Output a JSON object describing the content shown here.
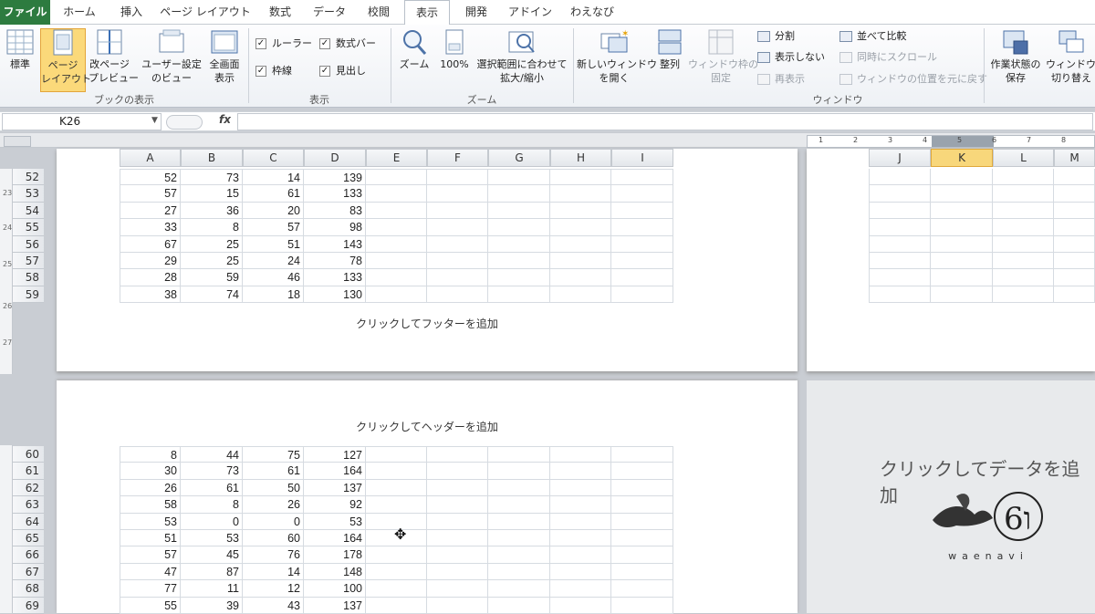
{
  "tabs": [
    "ファイル",
    "ホーム",
    "挿入",
    "ページ レイアウト",
    "数式",
    "データ",
    "校閲",
    "表示",
    "開発",
    "アドイン",
    "わえなび"
  ],
  "ribbon": {
    "workbook_views": {
      "normal": "標準",
      "page_layout": "ページ\nレイアウト",
      "page_break": "改ページ\nプレビュー",
      "custom": "ユーザー設定\nのビュー",
      "fullscreen": "全画面\n表示",
      "group": "ブックの表示"
    },
    "show": {
      "ruler": "ルーラー",
      "formula_bar": "数式バー",
      "gridlines": "枠線",
      "headings": "見出し",
      "group": "表示"
    },
    "zoom": {
      "zoom": "ズーム",
      "hundred": "100%",
      "selection": "選択範囲に合わせて\n拡大/縮小",
      "group": "ズーム"
    },
    "window": {
      "new_window": "新しいウィンドウ\nを開く",
      "arrange": "整列",
      "freeze": "ウィンドウ枠の\n固定",
      "split": "分割",
      "hide": "表示しない",
      "unhide": "再表示",
      "side_by_side": "並べて比較",
      "sync_scroll": "同時にスクロール",
      "reset_pos": "ウィンドウの位置を元に戻す",
      "save_ws": "作業状態の\n保存",
      "switch": "ウィンドウの\n切り替え",
      "group": "ウィンドウ"
    }
  },
  "namebox": "K26",
  "fx": "fx",
  "left_cols": [
    "A",
    "B",
    "C",
    "D",
    "E",
    "F",
    "G",
    "H",
    "I"
  ],
  "right_cols": [
    "J",
    "K",
    "L",
    "M"
  ],
  "footer_text": "クリックしてフッターを追加",
  "header_text": "クリックしてヘッダーを追加",
  "add_data_text": "クリックしてデータを追加",
  "watermark": "waenavi",
  "rows_top": [
    {
      "n": "52",
      "v": [
        "52",
        "73",
        "14",
        "139"
      ]
    },
    {
      "n": "53",
      "v": [
        "57",
        "15",
        "61",
        "133"
      ]
    },
    {
      "n": "54",
      "v": [
        "27",
        "36",
        "20",
        "83"
      ]
    },
    {
      "n": "55",
      "v": [
        "33",
        "8",
        "57",
        "98"
      ]
    },
    {
      "n": "56",
      "v": [
        "67",
        "25",
        "51",
        "143"
      ]
    },
    {
      "n": "57",
      "v": [
        "29",
        "25",
        "24",
        "78"
      ]
    },
    {
      "n": "58",
      "v": [
        "28",
        "59",
        "46",
        "133"
      ]
    },
    {
      "n": "59",
      "v": [
        "38",
        "74",
        "18",
        "130"
      ]
    }
  ],
  "rows_bottom": [
    {
      "n": "60",
      "v": [
        "8",
        "44",
        "75",
        "127"
      ]
    },
    {
      "n": "61",
      "v": [
        "30",
        "73",
        "61",
        "164"
      ]
    },
    {
      "n": "62",
      "v": [
        "26",
        "61",
        "50",
        "137"
      ]
    },
    {
      "n": "63",
      "v": [
        "58",
        "8",
        "26",
        "92"
      ]
    },
    {
      "n": "64",
      "v": [
        "53",
        "0",
        "0",
        "53"
      ]
    },
    {
      "n": "65",
      "v": [
        "51",
        "53",
        "60",
        "164"
      ]
    },
    {
      "n": "66",
      "v": [
        "57",
        "45",
        "76",
        "178"
      ]
    },
    {
      "n": "67",
      "v": [
        "47",
        "87",
        "14",
        "148"
      ]
    },
    {
      "n": "68",
      "v": [
        "77",
        "11",
        "12",
        "100"
      ]
    },
    {
      "n": "69",
      "v": [
        "55",
        "39",
        "43",
        "137"
      ]
    }
  ],
  "ruler_numbers": [
    "1",
    "2",
    "3",
    "4",
    "5",
    "6",
    "7",
    "8"
  ]
}
